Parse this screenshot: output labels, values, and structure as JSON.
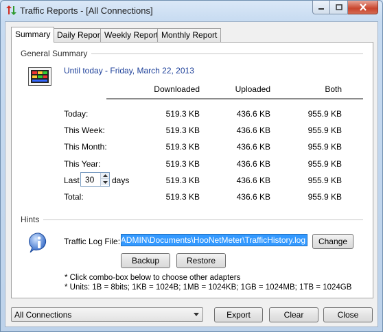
{
  "window": {
    "title": "Traffic Reports - [All Connections]"
  },
  "tabs": [
    {
      "label": "Summary",
      "active": true
    },
    {
      "label": "Daily Report",
      "active": false
    },
    {
      "label": "Weekly Report",
      "active": false
    },
    {
      "label": "Monthly Report",
      "active": false
    }
  ],
  "general": {
    "section_title": "General Summary",
    "until_text": "Until today - Friday, March 22, 2013",
    "columns": {
      "downloaded": "Downloaded",
      "uploaded": "Uploaded",
      "both": "Both"
    },
    "rows": [
      {
        "label": "Today:",
        "downloaded": "519.3 KB",
        "uploaded": "436.6 KB",
        "both": "955.9 KB"
      },
      {
        "label": "This Week:",
        "downloaded": "519.3 KB",
        "uploaded": "436.6 KB",
        "both": "955.9 KB"
      },
      {
        "label": "This Month:",
        "downloaded": "519.3 KB",
        "uploaded": "436.6 KB",
        "both": "955.9 KB"
      },
      {
        "label": "This Year:",
        "downloaded": "519.3 KB",
        "uploaded": "436.6 KB",
        "both": "955.9 KB"
      },
      {
        "label": "Last",
        "days_value": "30",
        "days_suffix": "days",
        "downloaded": "519.3 KB",
        "uploaded": "436.6 KB",
        "both": "955.9 KB"
      },
      {
        "label": "Total:",
        "downloaded": "519.3 KB",
        "uploaded": "436.6 KB",
        "both": "955.9 KB"
      }
    ]
  },
  "hints": {
    "section_title": "Hints",
    "log_label": "Traffic Log File:",
    "log_path": "C:\\Users\\ADMIN\\Documents\\HooNetMeter\\TrafficHistory.log",
    "change_label": "Change",
    "backup_label": "Backup",
    "restore_label": "Restore",
    "note1": "* Click combo-box below to choose other adapters",
    "note2": "* Units: 1B = 8bits; 1KB = 1024B; 1MB = 1024KB; 1GB = 1024MB; 1TB = 1024GB"
  },
  "footer": {
    "adapter_selected": "All Connections",
    "export_label": "Export",
    "clear_label": "Clear",
    "close_label": "Close"
  },
  "colors": {
    "accent_blue": "#1c3f99",
    "selection": "#3399ff"
  }
}
